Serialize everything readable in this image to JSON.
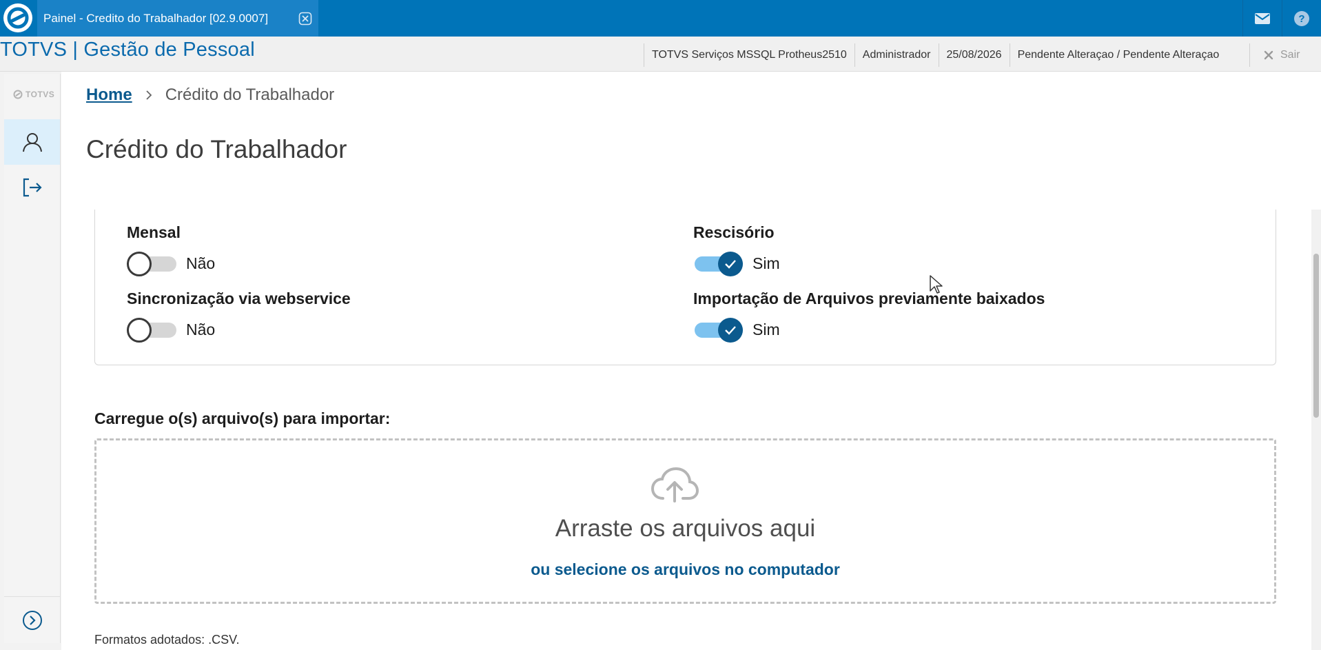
{
  "tab": {
    "title": "Painel - Credito do Trabalhador [02.9.0007]"
  },
  "header": {
    "app_title": "TOTVS | Gestão de Pessoal",
    "environment": "TOTVS Serviços MSSQL Protheus2510",
    "user": "Administrador",
    "date": "25/08/2026",
    "status": "Pendente Alteraçao / Pendente Alteraçao",
    "logout_label": "Sair"
  },
  "sidebar": {
    "logo_text": "TOTVS",
    "items": [
      {
        "icon": "user-icon",
        "active": true
      },
      {
        "icon": "logout-icon",
        "active": false
      }
    ],
    "expand_icon": "chevron-right-circle-icon"
  },
  "breadcrumb": {
    "home": "Home",
    "current": "Crédito do Trabalhador"
  },
  "page": {
    "title": "Crédito do Trabalhador"
  },
  "options": {
    "mensal": {
      "label": "Mensal",
      "state": "Não",
      "on": false
    },
    "rescisorio": {
      "label": "Rescisório",
      "state": "Sim",
      "on": true
    },
    "webservice": {
      "label": "Sincronização via webservice",
      "state": "Não",
      "on": false
    },
    "importacao": {
      "label": "Importação de Arquivos previamente baixados",
      "state": "Sim",
      "on": true
    }
  },
  "upload": {
    "label": "Carregue o(s) arquivo(s) para importar:",
    "drop_title": "Arraste os arquivos aqui",
    "select_link": "ou selecione os arquivos no computador",
    "formats": "Formatos adotados: .CSV."
  },
  "colors": {
    "brand": "#0074b8",
    "accent": "#0b5a8e",
    "toggle_on_track": "#7dc2ef"
  }
}
